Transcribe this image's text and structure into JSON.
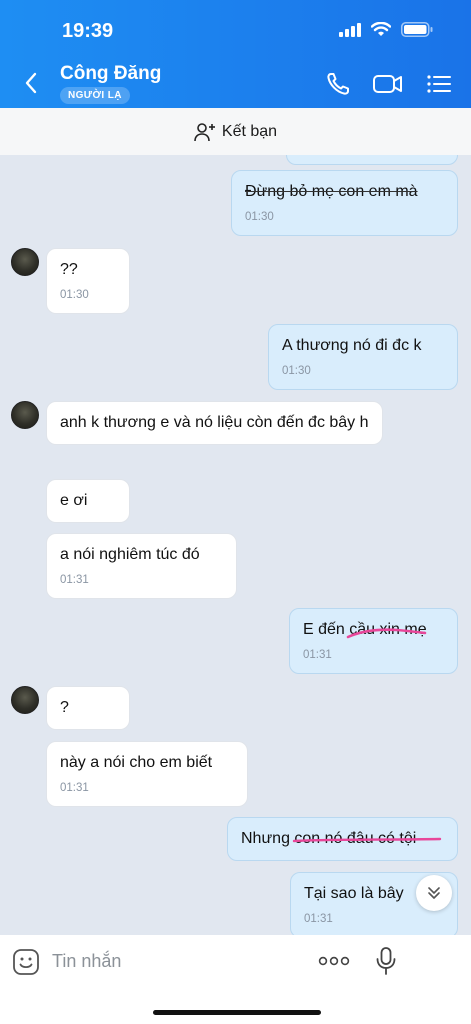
{
  "status_bar": {
    "time": "19:39"
  },
  "header": {
    "contact_name": "Công Đăng",
    "badge": "NGƯỜI LẠ",
    "icons": [
      "back-icon",
      "phone-icon",
      "video-call-icon",
      "menu-list-icon"
    ],
    "color": "#1a73e8"
  },
  "friend_bar": {
    "label": "Kết bạn",
    "icon": "add-person-icon"
  },
  "messages": [
    {
      "side": "out",
      "text": "Đừng bỏ mẹ con em mà",
      "time": "01:30",
      "struck": true
    },
    {
      "side": "in",
      "text": "??",
      "time": "01:30"
    },
    {
      "side": "out",
      "text": "A thương nó đi đc k",
      "time": "01:30"
    },
    {
      "side": "in",
      "text": "anh k thương e và nó liệu còn đến đc bây h"
    },
    {
      "side": "in",
      "text": "e ơi"
    },
    {
      "side": "in",
      "text": "a nói nghiêm túc đó",
      "time": "01:31"
    },
    {
      "side": "out",
      "text": "E đến cầu xin mẹ",
      "time": "01:31"
    },
    {
      "side": "in",
      "text": "?"
    },
    {
      "side": "in",
      "text": "này a nói cho em biết",
      "time": "01:31"
    },
    {
      "side": "out",
      "text_plain": "Nhưng ",
      "text_struck": "con nó đâu có tội"
    },
    {
      "side": "out",
      "text": "Tại sao là bây",
      "time": "01:31"
    }
  ],
  "input": {
    "placeholder": "Tin nhắn"
  }
}
